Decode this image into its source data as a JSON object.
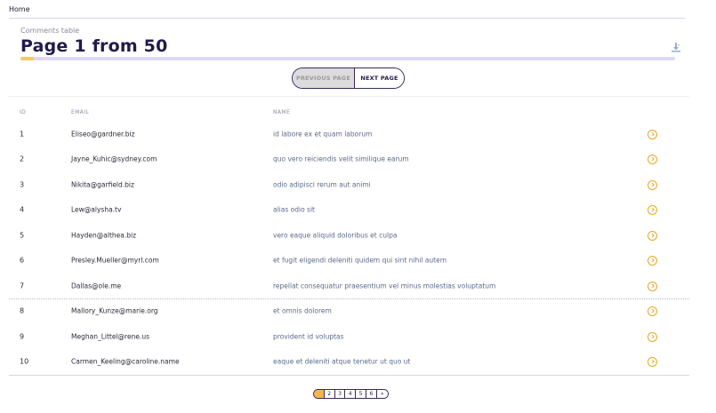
{
  "breadcrumb": {
    "home": "Home"
  },
  "header": {
    "subtitle": "Comments table",
    "title": "Page 1 from 50",
    "progress_fraction": 0.02
  },
  "pager": {
    "previous_label": "PREVIOUS PAGE",
    "next_label": "NEXT PAGE"
  },
  "table": {
    "headers": {
      "id": "ID",
      "email": "EMAIL",
      "name": "NAME"
    },
    "rows": [
      {
        "id": "1",
        "email": "Eliseo@gardner.biz",
        "name": "id labore ex et quam laborum"
      },
      {
        "id": "2",
        "email": "Jayne_Kuhic@sydney.com",
        "name": "quo vero reiciendis velit similique earum"
      },
      {
        "id": "3",
        "email": "Nikita@garfield.biz",
        "name": "odio adipisci rerum aut animi"
      },
      {
        "id": "4",
        "email": "Lew@alysha.tv",
        "name": "alias odio sit"
      },
      {
        "id": "5",
        "email": "Hayden@althea.biz",
        "name": "vero eaque aliquid doloribus et culpa"
      },
      {
        "id": "6",
        "email": "Presley.Mueller@myrl.com",
        "name": "et fugit eligendi deleniti quidem qui sint nihil autem"
      },
      {
        "id": "7",
        "email": "Dallas@ole.me",
        "name": "repellat consequatur praesentium vel minus molestias voluptatum"
      },
      {
        "id": "8",
        "email": "Mallory_Kunze@marie.org",
        "name": "et omnis dolorem"
      },
      {
        "id": "9",
        "email": "Meghan_Littel@rene.us",
        "name": "provident id voluptas"
      },
      {
        "id": "10",
        "email": "Carmen_Keeling@caroline.name",
        "name": "eaque et deleniti atque tenetur ut quo ut"
      }
    ]
  },
  "pagination": {
    "pages": [
      "1",
      "2",
      "3",
      "4",
      "5",
      "6"
    ],
    "next": "»",
    "current": "1"
  },
  "colors": {
    "accent": "#f5b54a",
    "title": "#221a4a",
    "progress_track": "#ddd8fb"
  },
  "icons": {
    "export": "export-icon",
    "row_action": "chevron-right-circle-icon"
  }
}
